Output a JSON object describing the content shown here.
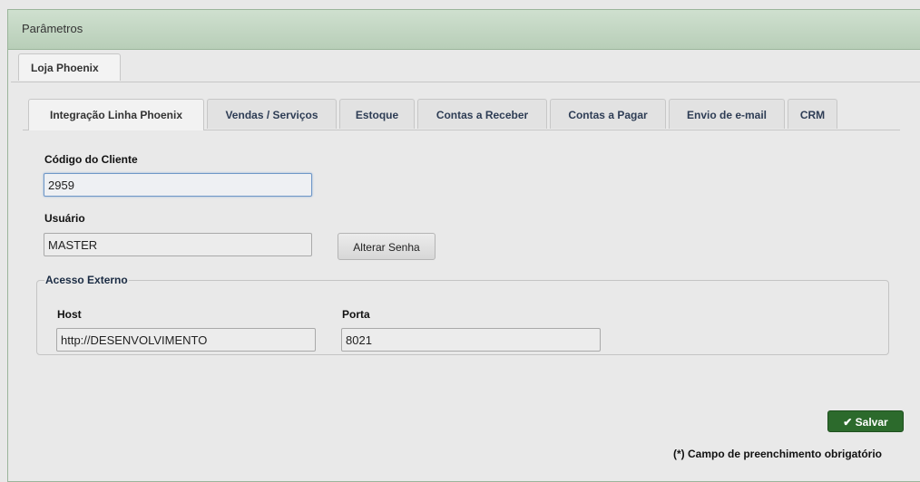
{
  "window": {
    "title": "Parâmetros"
  },
  "outer_tabs": [
    {
      "label": "Loja Phoenix"
    }
  ],
  "tabs": [
    {
      "label": "Integração Linha Phoenix",
      "active": true
    },
    {
      "label": "Vendas / Serviços"
    },
    {
      "label": "Estoque"
    },
    {
      "label": "Contas a Receber"
    },
    {
      "label": "Contas a Pagar"
    },
    {
      "label": "Envio de e-mail"
    },
    {
      "label": "CRM"
    }
  ],
  "form": {
    "client_code": {
      "label": "Código do Cliente",
      "value": "2959"
    },
    "user": {
      "label": "Usuário",
      "value": "MASTER"
    },
    "change_password_label": "Alterar Senha",
    "external_access": {
      "legend": "Acesso Externo",
      "host": {
        "label": "Host",
        "value": "http://DESENVOLVIMENTO"
      },
      "port": {
        "label": "Porta",
        "value": "8021"
      }
    }
  },
  "footer": {
    "save_label": "Salvar",
    "save_icon": "checkmark-icon",
    "required_note": "(*) Campo de preenchimento obrigatório"
  }
}
